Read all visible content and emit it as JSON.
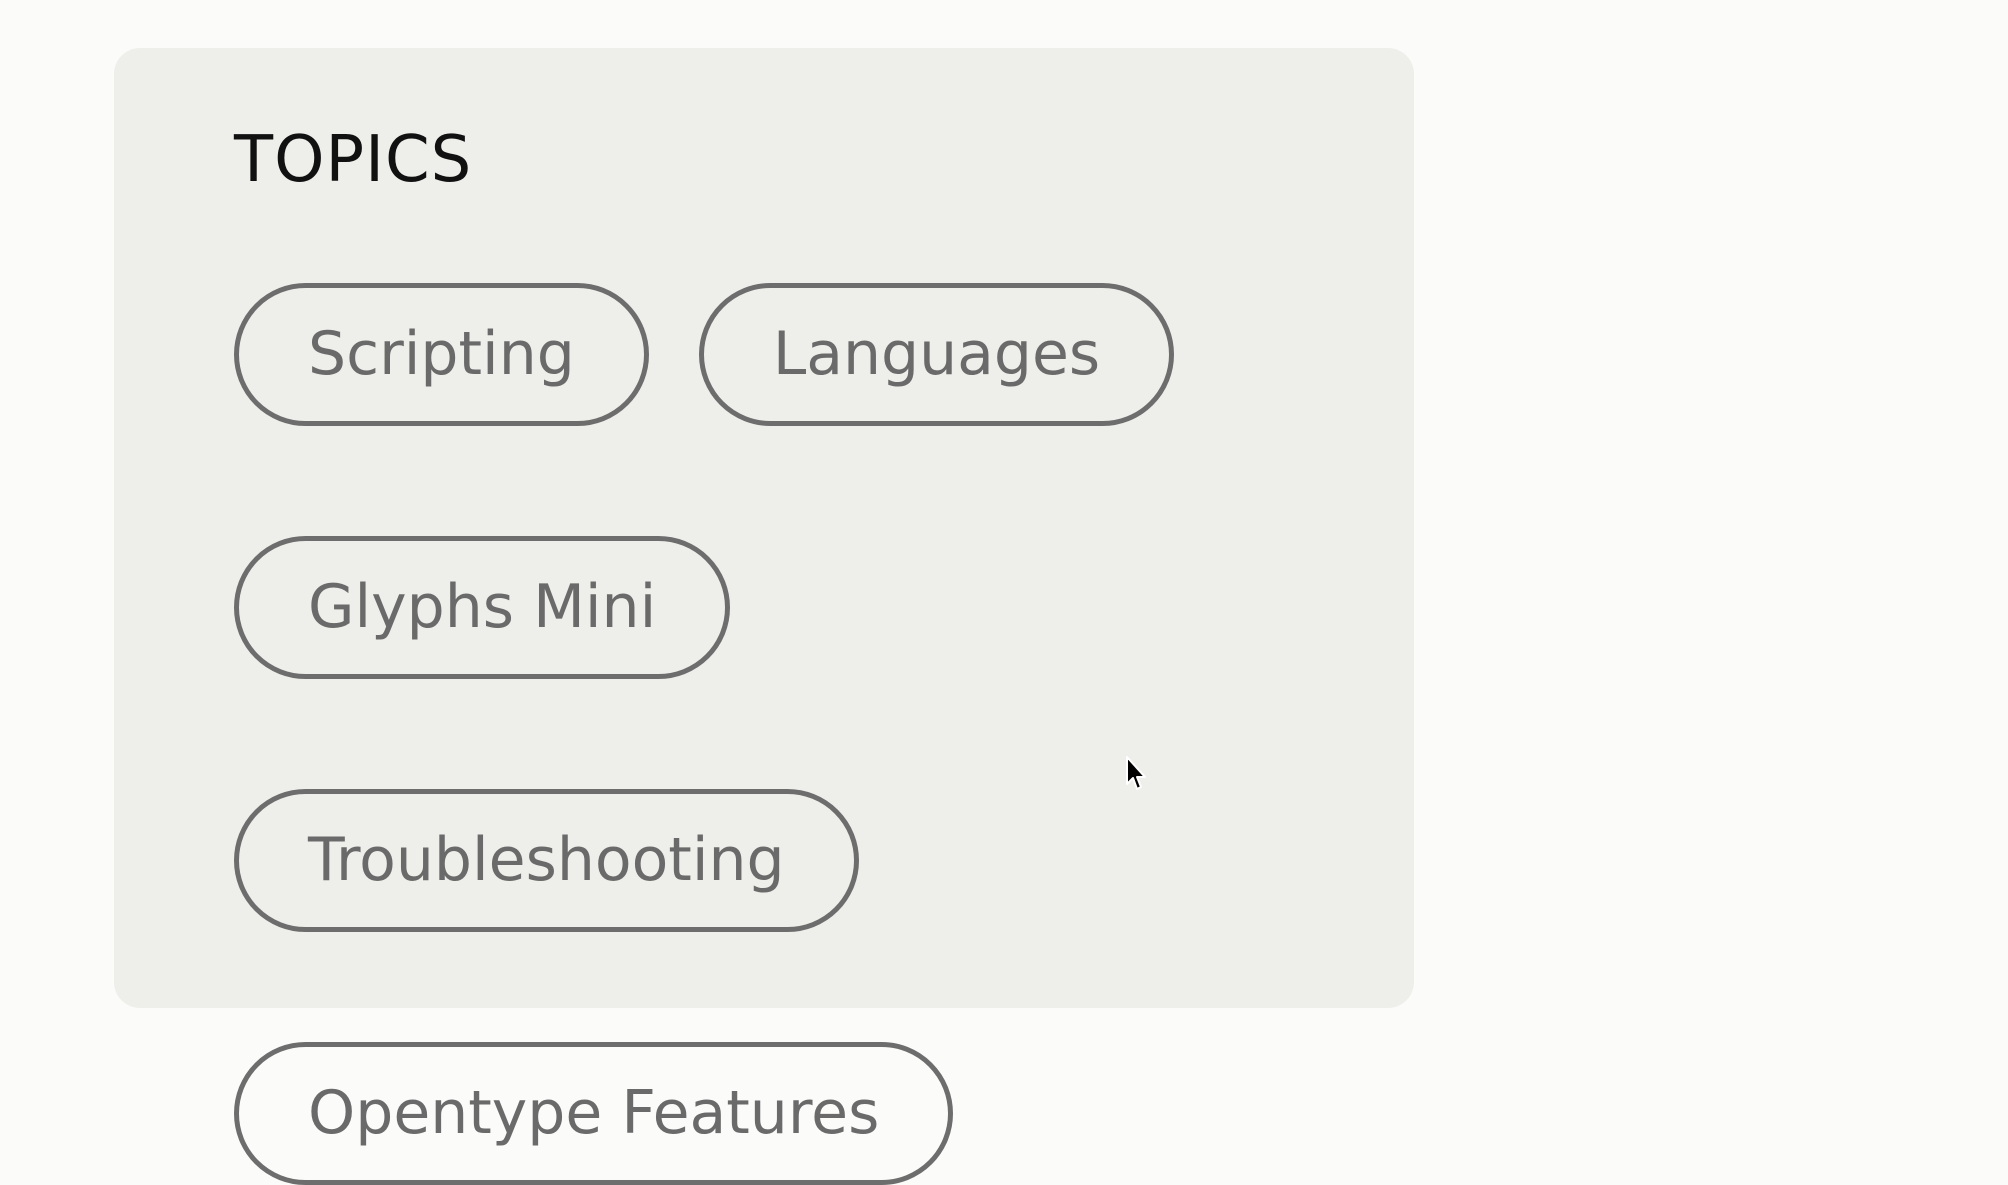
{
  "topics": {
    "title": "TOPICS",
    "tags": [
      {
        "label": "Scripting"
      },
      {
        "label": "Languages"
      },
      {
        "label": "Glyphs Mini"
      },
      {
        "label": "Troubleshooting"
      },
      {
        "label": "Opentype Features"
      }
    ]
  },
  "colors": {
    "page_background": "#fbfbfa",
    "panel_background": "#eeeeea",
    "tag_border": "#6d6d6d",
    "tag_text": "#6a6a6a",
    "title_text": "#111111"
  },
  "icons": {
    "cursor": "mouse-pointer-icon"
  }
}
